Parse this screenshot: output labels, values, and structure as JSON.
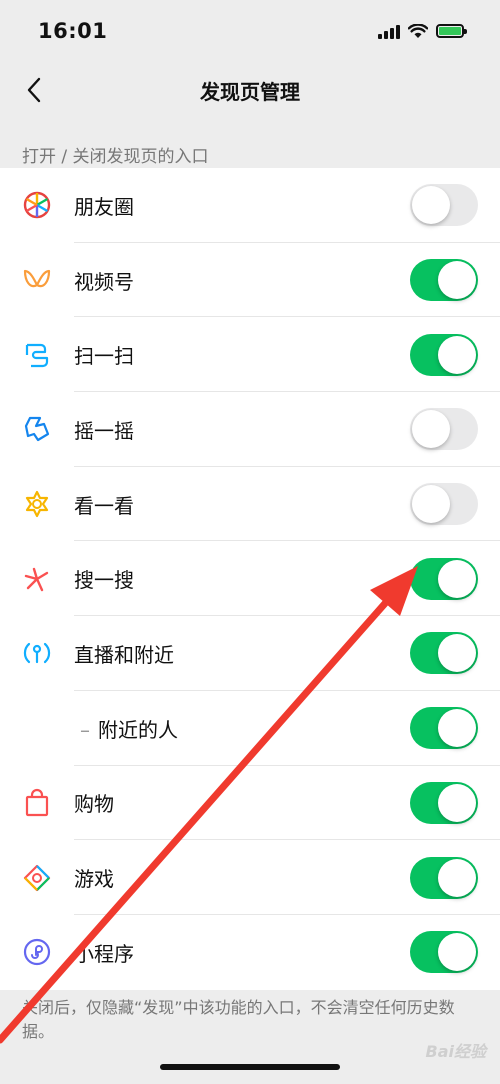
{
  "status_bar": {
    "time": "16:01"
  },
  "nav": {
    "title": "发现页管理"
  },
  "section": {
    "header": "打开 / 关闭发现页的入口"
  },
  "items": [
    {
      "label": "朋友圈",
      "icon": "moments-icon",
      "enabled": false
    },
    {
      "label": "视频号",
      "icon": "channels-icon",
      "enabled": true
    },
    {
      "label": "扫一扫",
      "icon": "scan-icon",
      "enabled": true
    },
    {
      "label": "摇一摇",
      "icon": "shake-icon",
      "enabled": false
    },
    {
      "label": "看一看",
      "icon": "top-stories-icon",
      "enabled": false
    },
    {
      "label": "搜一搜",
      "icon": "search-icon",
      "enabled": true
    },
    {
      "label": "直播和附近",
      "icon": "live-nearby-icon",
      "enabled": true
    },
    {
      "label": "附近的人",
      "icon": "",
      "enabled": true
    },
    {
      "label": "购物",
      "icon": "shopping-bag-icon",
      "enabled": true
    },
    {
      "label": "游戏",
      "icon": "games-icon",
      "enabled": true
    },
    {
      "label": "小程序",
      "icon": "mini-programs-icon",
      "enabled": true
    }
  ],
  "footer": {
    "note": "关闭后，仅隐藏“发现”中该功能的入口，不会清空任何历史数据。"
  },
  "watermark": "Bai经验",
  "colors": {
    "toggle_on": "#07c160",
    "toggle_off": "#e9e9ea",
    "annotation_arrow": "#f03a2e"
  }
}
